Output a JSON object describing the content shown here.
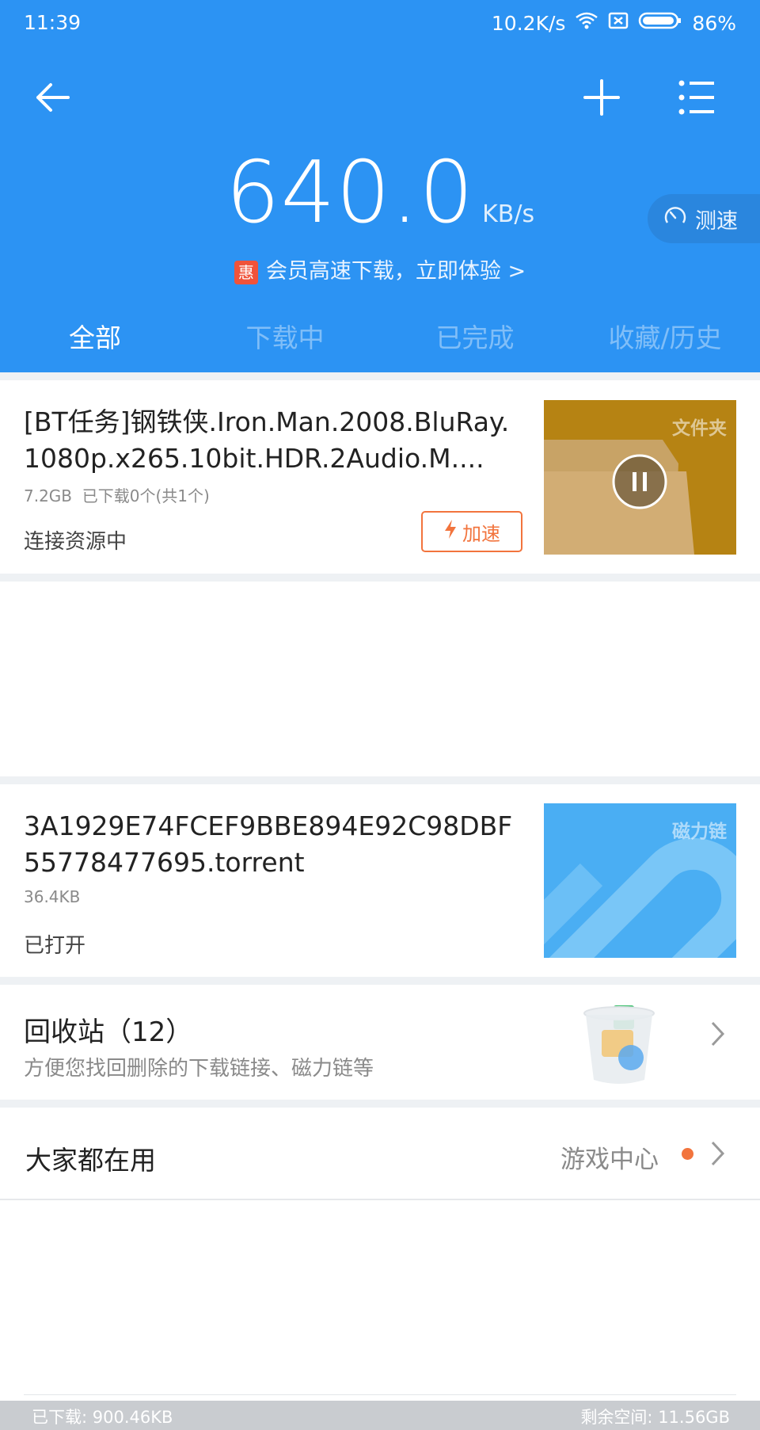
{
  "status_bar": {
    "time": "11:39",
    "net_speed": "10.2K/s",
    "battery": "86%"
  },
  "header": {
    "speed_value": "640.0",
    "speed_unit": "KB/s",
    "speedtest_label": "测速",
    "promo_badge": "惠",
    "promo_text": "会员高速下载，立即体验 >"
  },
  "tabs": [
    {
      "label": "全部",
      "active": true
    },
    {
      "label": "下载中",
      "active": false
    },
    {
      "label": "已完成",
      "active": false
    },
    {
      "label": "收藏/历史",
      "active": false
    }
  ],
  "tasks": [
    {
      "title": "[BT任务]钢铁侠.Iron.Man.2008.BluRay.1080p.x265.10bit.HDR.2Audio.M....",
      "meta": "7.2GB  已下载0个(共1个)",
      "status": "连接资源中",
      "thumb_label": "文件夹",
      "boost_label": "加速"
    },
    {
      "title": "3A1929E74FCEF9BBE894E92C98DBF55778477695.torrent",
      "meta": "36.4KB",
      "status": "已打开",
      "thumb_label": "磁力链"
    }
  ],
  "recycle": {
    "title": "回收站（12）",
    "subtitle": "方便您找回删除的下载链接、磁力链等"
  },
  "popular": {
    "title": "大家都在用",
    "right_label": "游戏中心"
  },
  "footer": {
    "downloaded": "已下载: 900.46KB",
    "free_space": "剩余空间: 11.56GB"
  },
  "colors": {
    "header_bg": "#2c93f3",
    "accent_orange": "#f2743d",
    "folder_thumb": "#b68313",
    "magnet_thumb": "#4aaef3"
  }
}
